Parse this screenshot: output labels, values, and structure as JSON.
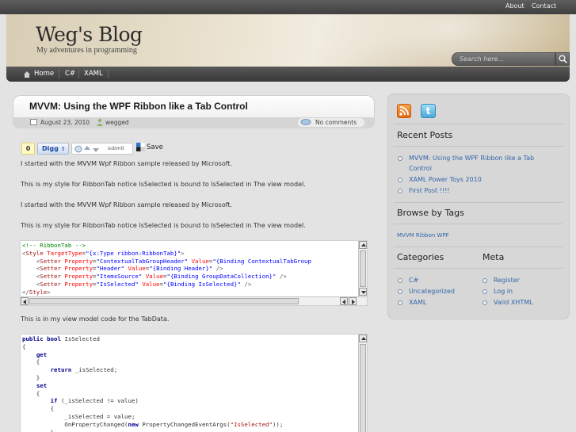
{
  "topbar": {
    "about": "About",
    "contact": "Contact"
  },
  "header": {
    "title": "Weg's Blog",
    "tagline": "My adventures in programming",
    "search_placeholder": "Search here..."
  },
  "nav": {
    "home": "Home",
    "csharp": "C#",
    "xaml": "XAML"
  },
  "post": {
    "title": "MVVM: Using the WPF Ribbon like a Tab Control",
    "date": "August 23, 2010",
    "author": "wegged",
    "comments": "No comments",
    "digg_count": "0",
    "digg_label": "Digg",
    "submit_label": "submit",
    "save_label": "Save",
    "p1": "I started with the MVVM Wpf Ribbon sample released by Microsoft.",
    "p2": "This is my style for RibbonTab notice IsSelected is bound to IsSelected in The view model.",
    "p3": "I started with the MVVM Wpf Ribbon sample released by Microsoft.",
    "p4": "This is my style for RibbonTab notice IsSelected is bound to IsSelected in The view model.",
    "p5": "This is in my view model code for the TabData."
  },
  "code1": {
    "l1_comment": "<!-- RibbonTab -->",
    "l2_style": "Style",
    "l2_attr": "TargetType",
    "l2_val": "\"{x:Type ribbon:RibbonTab}\"",
    "setter": "Setter",
    "property": "Property",
    "value": "Value",
    "l3_prop": "\"ContextualTabGroupHeader\"",
    "l3_val": "\"{Binding ContextualTabGroup",
    "l4_prop": "\"Header\"",
    "l4_val": "\"{Binding Header}\"",
    "l5_prop": "\"ItemsSource\"",
    "l5_val": "\"{Binding GroupDataCollection}\"",
    "l6_prop": "\"IsSelected\"",
    "l6_val": "\"{Binding IsSelected}\"",
    "l7_close": "Style"
  },
  "code2": {
    "l1_kw": "public bool",
    "l1_name": "IsSelected",
    "get": "get",
    "return": "return",
    "return_expr": "_isSelected;",
    "set": "set",
    "if": "if",
    "if_expr": "(_isSelected != value)",
    "assign": "_isSelected = value;",
    "notify_pre": "OnPropertyChanged(",
    "new": "new",
    "notify_mid": "PropertyChangedEventArgs(",
    "notify_str": "\"IsSelected\"",
    "notify_end": "));"
  },
  "sidebar": {
    "recent_title": "Recent Posts",
    "recent": [
      "MVVM: Using the WPF Ribbon like a Tab Control",
      "XAML Power Toys 2010",
      "First Post !!!!"
    ],
    "tags_title": "Browse by Tags",
    "tags": "MVVM Ribbon WPF",
    "categories_title": "Categories",
    "categories": [
      "C#",
      "Uncategorized",
      "XAML"
    ],
    "meta_title": "Meta",
    "meta": [
      "Register",
      "Log in",
      "Valid XHTML"
    ]
  }
}
